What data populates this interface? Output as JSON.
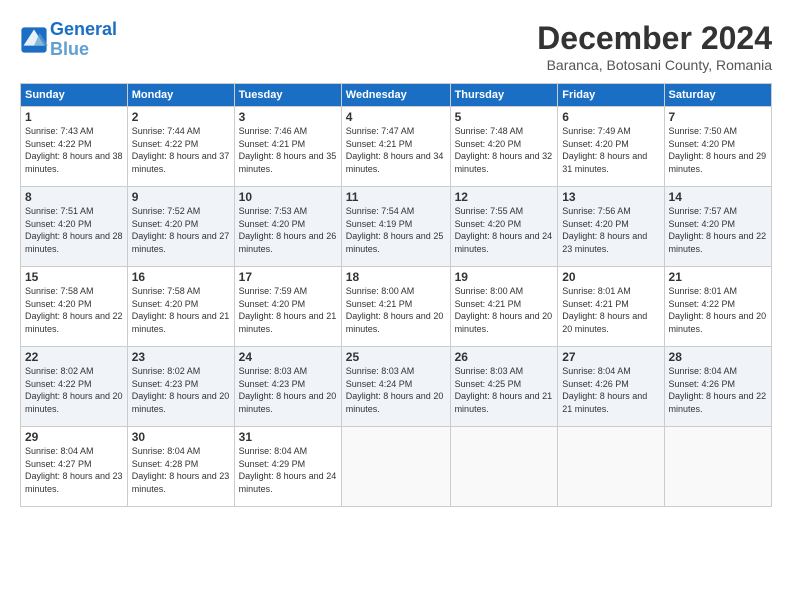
{
  "header": {
    "logo_line1": "General",
    "logo_line2": "Blue",
    "month": "December 2024",
    "location": "Baranca, Botosani County, Romania"
  },
  "days_of_week": [
    "Sunday",
    "Monday",
    "Tuesday",
    "Wednesday",
    "Thursday",
    "Friday",
    "Saturday"
  ],
  "weeks": [
    [
      {
        "day": "1",
        "sunrise": "7:43 AM",
        "sunset": "4:22 PM",
        "daylight": "8 hours and 38 minutes."
      },
      {
        "day": "2",
        "sunrise": "7:44 AM",
        "sunset": "4:22 PM",
        "daylight": "8 hours and 37 minutes."
      },
      {
        "day": "3",
        "sunrise": "7:46 AM",
        "sunset": "4:21 PM",
        "daylight": "8 hours and 35 minutes."
      },
      {
        "day": "4",
        "sunrise": "7:47 AM",
        "sunset": "4:21 PM",
        "daylight": "8 hours and 34 minutes."
      },
      {
        "day": "5",
        "sunrise": "7:48 AM",
        "sunset": "4:20 PM",
        "daylight": "8 hours and 32 minutes."
      },
      {
        "day": "6",
        "sunrise": "7:49 AM",
        "sunset": "4:20 PM",
        "daylight": "8 hours and 31 minutes."
      },
      {
        "day": "7",
        "sunrise": "7:50 AM",
        "sunset": "4:20 PM",
        "daylight": "8 hours and 29 minutes."
      }
    ],
    [
      {
        "day": "8",
        "sunrise": "7:51 AM",
        "sunset": "4:20 PM",
        "daylight": "8 hours and 28 minutes."
      },
      {
        "day": "9",
        "sunrise": "7:52 AM",
        "sunset": "4:20 PM",
        "daylight": "8 hours and 27 minutes."
      },
      {
        "day": "10",
        "sunrise": "7:53 AM",
        "sunset": "4:20 PM",
        "daylight": "8 hours and 26 minutes."
      },
      {
        "day": "11",
        "sunrise": "7:54 AM",
        "sunset": "4:19 PM",
        "daylight": "8 hours and 25 minutes."
      },
      {
        "day": "12",
        "sunrise": "7:55 AM",
        "sunset": "4:20 PM",
        "daylight": "8 hours and 24 minutes."
      },
      {
        "day": "13",
        "sunrise": "7:56 AM",
        "sunset": "4:20 PM",
        "daylight": "8 hours and 23 minutes."
      },
      {
        "day": "14",
        "sunrise": "7:57 AM",
        "sunset": "4:20 PM",
        "daylight": "8 hours and 22 minutes."
      }
    ],
    [
      {
        "day": "15",
        "sunrise": "7:58 AM",
        "sunset": "4:20 PM",
        "daylight": "8 hours and 22 minutes."
      },
      {
        "day": "16",
        "sunrise": "7:58 AM",
        "sunset": "4:20 PM",
        "daylight": "8 hours and 21 minutes."
      },
      {
        "day": "17",
        "sunrise": "7:59 AM",
        "sunset": "4:20 PM",
        "daylight": "8 hours and 21 minutes."
      },
      {
        "day": "18",
        "sunrise": "8:00 AM",
        "sunset": "4:21 PM",
        "daylight": "8 hours and 20 minutes."
      },
      {
        "day": "19",
        "sunrise": "8:00 AM",
        "sunset": "4:21 PM",
        "daylight": "8 hours and 20 minutes."
      },
      {
        "day": "20",
        "sunrise": "8:01 AM",
        "sunset": "4:21 PM",
        "daylight": "8 hours and 20 minutes."
      },
      {
        "day": "21",
        "sunrise": "8:01 AM",
        "sunset": "4:22 PM",
        "daylight": "8 hours and 20 minutes."
      }
    ],
    [
      {
        "day": "22",
        "sunrise": "8:02 AM",
        "sunset": "4:22 PM",
        "daylight": "8 hours and 20 minutes."
      },
      {
        "day": "23",
        "sunrise": "8:02 AM",
        "sunset": "4:23 PM",
        "daylight": "8 hours and 20 minutes."
      },
      {
        "day": "24",
        "sunrise": "8:03 AM",
        "sunset": "4:23 PM",
        "daylight": "8 hours and 20 minutes."
      },
      {
        "day": "25",
        "sunrise": "8:03 AM",
        "sunset": "4:24 PM",
        "daylight": "8 hours and 20 minutes."
      },
      {
        "day": "26",
        "sunrise": "8:03 AM",
        "sunset": "4:25 PM",
        "daylight": "8 hours and 21 minutes."
      },
      {
        "day": "27",
        "sunrise": "8:04 AM",
        "sunset": "4:26 PM",
        "daylight": "8 hours and 21 minutes."
      },
      {
        "day": "28",
        "sunrise": "8:04 AM",
        "sunset": "4:26 PM",
        "daylight": "8 hours and 22 minutes."
      }
    ],
    [
      {
        "day": "29",
        "sunrise": "8:04 AM",
        "sunset": "4:27 PM",
        "daylight": "8 hours and 23 minutes."
      },
      {
        "day": "30",
        "sunrise": "8:04 AM",
        "sunset": "4:28 PM",
        "daylight": "8 hours and 23 minutes."
      },
      {
        "day": "31",
        "sunrise": "8:04 AM",
        "sunset": "4:29 PM",
        "daylight": "8 hours and 24 minutes."
      },
      null,
      null,
      null,
      null
    ]
  ],
  "labels": {
    "sunrise": "Sunrise:",
    "sunset": "Sunset:",
    "daylight": "Daylight:"
  }
}
